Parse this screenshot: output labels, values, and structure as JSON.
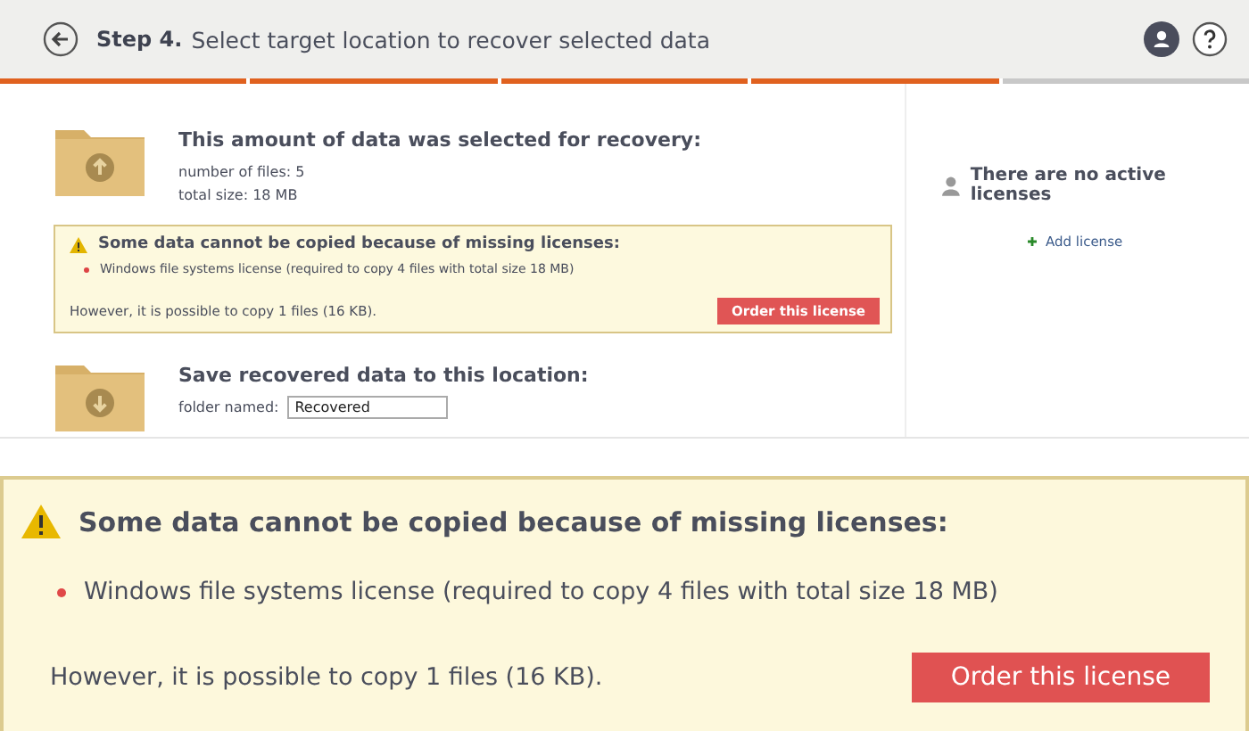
{
  "header": {
    "step": "Step 4.",
    "title": "Select target location to recover selected data"
  },
  "progress": [
    {
      "done": true
    },
    {
      "done": true
    },
    {
      "done": true
    },
    {
      "done": true
    },
    {
      "done": false
    }
  ],
  "selection": {
    "heading": "This amount of data was selected for recovery:",
    "lines": [
      "number of files: 5",
      "total size: 18 MB"
    ]
  },
  "warning": {
    "heading": "Some data cannot be copied because of missing licenses:",
    "items": [
      "Windows file systems license (required to copy 4 files with total size 18 MB)"
    ],
    "note": "However, it is possible to copy 1 files (16 KB).",
    "button": "Order this license"
  },
  "destination": {
    "heading": "Save recovered data to this location:",
    "label": "folder named:",
    "value": "Recovered"
  },
  "licenses": {
    "heading": "There are no active licenses",
    "link": "Add license"
  },
  "callout": {
    "heading": "Some data cannot be copied because of missing licenses:",
    "items": [
      "Windows file systems license (required to copy 4 files with total size 18 MB)"
    ],
    "note": "However, it is possible to copy 1 files (16 KB).",
    "button": "Order this license"
  }
}
